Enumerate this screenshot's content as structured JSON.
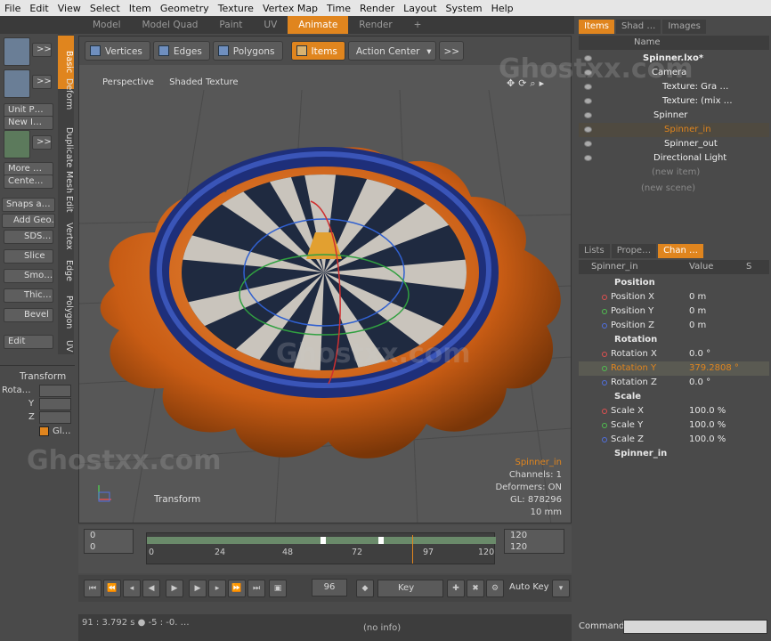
{
  "menu": [
    "File",
    "Edit",
    "View",
    "Select",
    "Item",
    "Geometry",
    "Texture",
    "Vertex Map",
    "Time",
    "Render",
    "Layout",
    "System",
    "Help"
  ],
  "layout_tabs": [
    {
      "label": "Model",
      "active": false
    },
    {
      "label": "Model Quad",
      "active": false
    },
    {
      "label": "Paint",
      "active": false
    },
    {
      "label": "UV",
      "active": false
    },
    {
      "label": "Animate",
      "active": true
    },
    {
      "label": "Render",
      "active": false
    },
    {
      "label": "+",
      "active": false
    }
  ],
  "left_tools": {
    "unit_popup": "Unit P…",
    "new_item": "New I…",
    "more": "More …",
    "center": "Cente…",
    "snaps": "Snaps a…",
    "add_geo": "Add Geo…",
    "sds": "SDS…",
    "slice": "Slice",
    "smooth": "Smo…",
    "thicken": "Thic…",
    "bevel": "Bevel",
    "edit": "Edit",
    "expand1": ">>",
    "expand2": ">>",
    "expand3": ">>"
  },
  "vertical_tabs": [
    "Basic",
    "Deform",
    "Duplicate",
    "Mesh Edit",
    "Vertex",
    "Edge",
    "Polygon",
    "UV"
  ],
  "transform_panel": {
    "title": "Transform",
    "rot": "Rota…",
    "y": "Y",
    "z": "Z",
    "gl": "Gl…"
  },
  "viewport_toolbar": {
    "vertices": "Vertices",
    "edges": "Edges",
    "polygons": "Polygons",
    "items": "Items",
    "action_center": "Action Center",
    "more": ">>"
  },
  "viewport": {
    "view": "Perspective",
    "shading": "Shaded Texture",
    "tool": "Transform"
  },
  "viewport_info": {
    "item": "Spinner_in",
    "channels": "Channels: 1",
    "deformers": "Deformers: ON",
    "gl": "GL: 878296",
    "scale": "10 mm"
  },
  "timeline": {
    "start1": "0",
    "start2": "0",
    "end1": "120",
    "end2": "120",
    "ticks": [
      "0",
      "24",
      "48",
      "72",
      "97",
      "120"
    ],
    "current": "96"
  },
  "transport": {
    "key_label": "Key",
    "auto_key": "Auto Key"
  },
  "status": {
    "left": "91 : 3.792 s ● -5 : -0. …",
    "info": "(no info)",
    "command": "Command"
  },
  "items_panel": {
    "tabs": [
      {
        "label": "Items",
        "active": true
      },
      {
        "label": "Shad …",
        "active": false
      },
      {
        "label": "Images",
        "active": false
      }
    ],
    "header_name": "Name",
    "rows": [
      {
        "label": "Spinner.lxo*",
        "bold": true,
        "selected": false
      },
      {
        "label": "Camera",
        "bold": false,
        "selected": false
      },
      {
        "label": "Texture: Gra …",
        "bold": false,
        "selected": false
      },
      {
        "label": "Texture: (mix …",
        "bold": false,
        "selected": false
      },
      {
        "label": "Spinner",
        "bold": false,
        "selected": false
      },
      {
        "label": "Spinner_in",
        "bold": false,
        "selected": true
      },
      {
        "label": "Spinner_out",
        "bold": false,
        "selected": false
      },
      {
        "label": "Directional Light",
        "bold": false,
        "selected": false
      }
    ],
    "new_item": "(new item)",
    "new_scene": "(new scene)"
  },
  "channels_panel": {
    "tabs": [
      {
        "label": "Lists",
        "active": false
      },
      {
        "label": "Prope…",
        "active": false
      },
      {
        "label": "Chan …",
        "active": true
      }
    ],
    "header_name": "Spinner_in",
    "header_value": "Value",
    "header_s": "S",
    "rows": [
      {
        "group": true,
        "label": "Position",
        "value": "",
        "dot": ""
      },
      {
        "group": false,
        "label": "Position X",
        "value": "0 m",
        "dot": "#e05050"
      },
      {
        "group": false,
        "label": "Position Y",
        "value": "0 m",
        "dot": "#50c050"
      },
      {
        "group": false,
        "label": "Position Z",
        "value": "0 m",
        "dot": "#5070e0"
      },
      {
        "group": true,
        "label": "Rotation",
        "value": "",
        "dot": ""
      },
      {
        "group": false,
        "label": "Rotation X",
        "value": "0.0 °",
        "dot": "#e05050"
      },
      {
        "group": false,
        "label": "Rotation Y",
        "value": "379.2808 °",
        "dot": "#50c050",
        "selected": true
      },
      {
        "group": false,
        "label": "Rotation Z",
        "value": "0.0 °",
        "dot": "#5070e0"
      },
      {
        "group": true,
        "label": "Scale",
        "value": "",
        "dot": ""
      },
      {
        "group": false,
        "label": "Scale X",
        "value": "100.0 %",
        "dot": "#e05050"
      },
      {
        "group": false,
        "label": "Scale Y",
        "value": "100.0 %",
        "dot": "#50c050"
      },
      {
        "group": false,
        "label": "Scale Z",
        "value": "100.0 %",
        "dot": "#5070e0"
      },
      {
        "group": true,
        "label": "Spinner_in",
        "value": "",
        "dot": ""
      }
    ]
  },
  "watermark": "Ghostxx.com",
  "colors": {
    "accent": "#e0851e",
    "object_orange": "#d2691e",
    "ring_blue": "#2a3d8f"
  }
}
